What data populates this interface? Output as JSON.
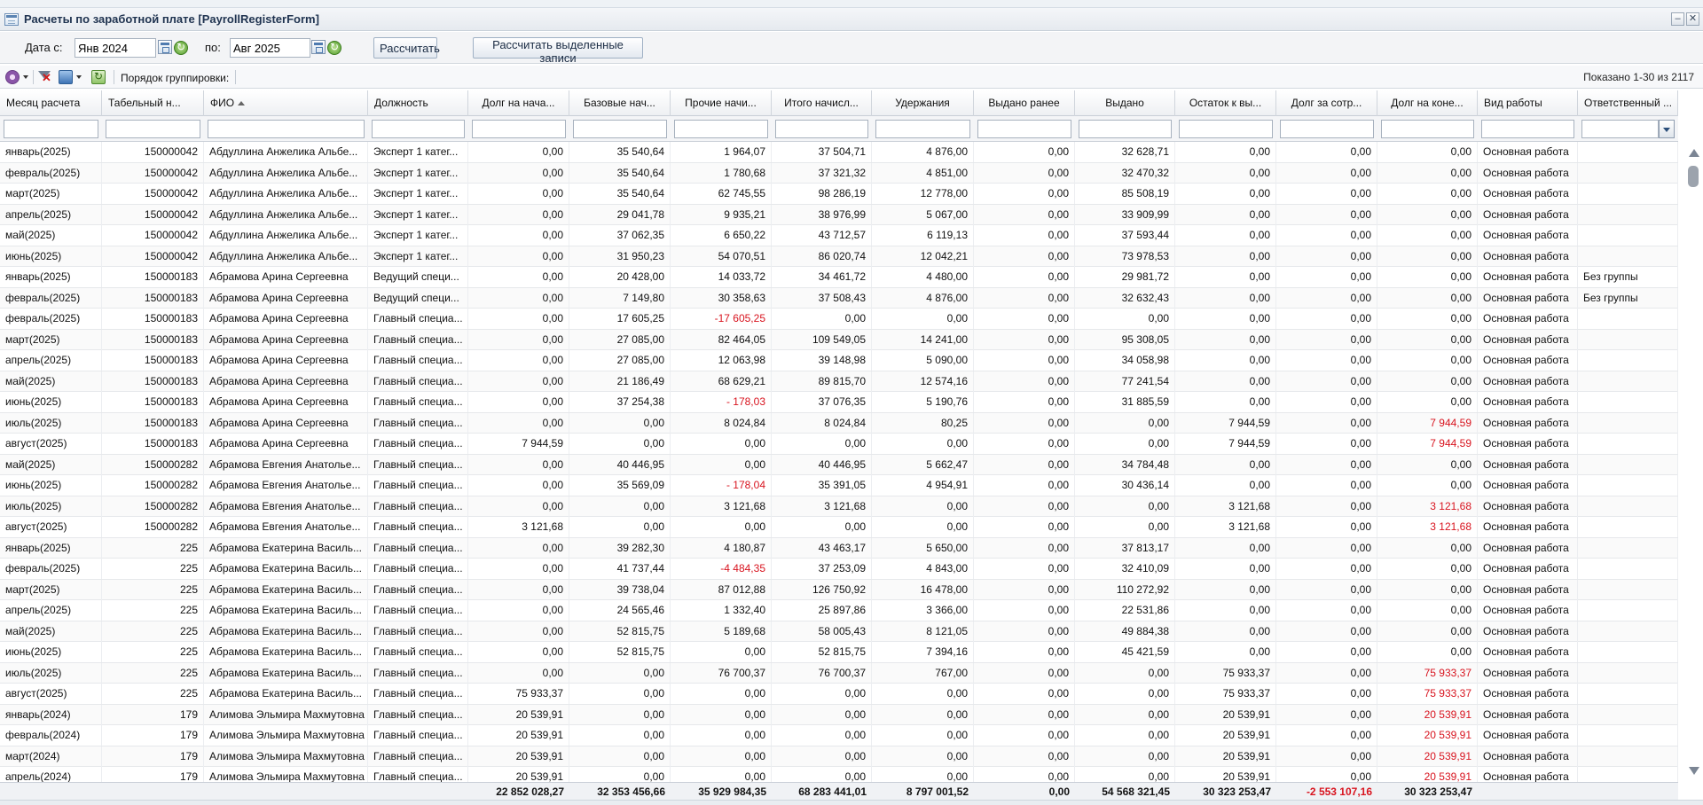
{
  "window": {
    "title": "Расчеты по заработной плате [PayrollRegisterForm]"
  },
  "filter": {
    "date_from_label": "Дата с:",
    "date_from_value": "Янв 2024",
    "date_to_label": "по:",
    "date_to_value": "Авг 2025",
    "calculate_label": "Рассчитать",
    "calculate_selected_label": "Рассчитать выделенные записи"
  },
  "toolbar": {
    "grouping_label": "Порядок группировки:",
    "paging": "Показано 1-30 из 2117"
  },
  "columns": [
    "Месяц расчета",
    "Табельный н...",
    "ФИО",
    "Должность",
    "Долг на нача...",
    "Базовые нач...",
    "Прочие начи...",
    "Итого начисл...",
    "Удержания",
    "Выдано ранее",
    "Выдано",
    "Остаток к вы...",
    "Долг за сотр...",
    "Долг на коне...",
    "Вид работы",
    "Ответственный ..."
  ],
  "rows": [
    [
      "январь(2025)",
      "150000042",
      "Абдуллина Анжелика Альбе...",
      "Эксперт 1 катег...",
      "0,00",
      "35 540,64",
      "1 964,07",
      "37 504,71",
      "4 876,00",
      "0,00",
      "32 628,71",
      "0,00",
      "0,00",
      "0,00",
      "Основная работа",
      ""
    ],
    [
      "февраль(2025)",
      "150000042",
      "Абдуллина Анжелика Альбе...",
      "Эксперт 1 катег...",
      "0,00",
      "35 540,64",
      "1 780,68",
      "37 321,32",
      "4 851,00",
      "0,00",
      "32 470,32",
      "0,00",
      "0,00",
      "0,00",
      "Основная работа",
      ""
    ],
    [
      "март(2025)",
      "150000042",
      "Абдуллина Анжелика Альбе...",
      "Эксперт 1 катег...",
      "0,00",
      "35 540,64",
      "62 745,55",
      "98 286,19",
      "12 778,00",
      "0,00",
      "85 508,19",
      "0,00",
      "0,00",
      "0,00",
      "Основная работа",
      ""
    ],
    [
      "апрель(2025)",
      "150000042",
      "Абдуллина Анжелика Альбе...",
      "Эксперт 1 катег...",
      "0,00",
      "29 041,78",
      "9 935,21",
      "38 976,99",
      "5 067,00",
      "0,00",
      "33 909,99",
      "0,00",
      "0,00",
      "0,00",
      "Основная работа",
      ""
    ],
    [
      "май(2025)",
      "150000042",
      "Абдуллина Анжелика Альбе...",
      "Эксперт 1 катег...",
      "0,00",
      "37 062,35",
      "6 650,22",
      "43 712,57",
      "6 119,13",
      "0,00",
      "37 593,44",
      "0,00",
      "0,00",
      "0,00",
      "Основная работа",
      ""
    ],
    [
      "июнь(2025)",
      "150000042",
      "Абдуллина Анжелика Альбе...",
      "Эксперт 1 катег...",
      "0,00",
      "31 950,23",
      "54 070,51",
      "86 020,74",
      "12 042,21",
      "0,00",
      "73 978,53",
      "0,00",
      "0,00",
      "0,00",
      "Основная работа",
      ""
    ],
    [
      "январь(2025)",
      "150000183",
      "Абрамова Арина Сергеевна",
      "Ведущий специ...",
      "0,00",
      "20 428,00",
      "14 033,72",
      "34 461,72",
      "4 480,00",
      "0,00",
      "29 981,72",
      "0,00",
      "0,00",
      "0,00",
      "Основная работа",
      "Без группы"
    ],
    [
      "февраль(2025)",
      "150000183",
      "Абрамова Арина Сергеевна",
      "Ведущий специ...",
      "0,00",
      "7 149,80",
      "30 358,63",
      "37 508,43",
      "4 876,00",
      "0,00",
      "32 632,43",
      "0,00",
      "0,00",
      "0,00",
      "Основная работа",
      "Без группы"
    ],
    [
      "февраль(2025)",
      "150000183",
      "Абрамова Арина Сергеевна",
      "Главный специа...",
      "0,00",
      "17 605,25",
      "-17 605,25",
      "0,00",
      "0,00",
      "0,00",
      "0,00",
      "0,00",
      "0,00",
      "0,00",
      "Основная работа",
      ""
    ],
    [
      "март(2025)",
      "150000183",
      "Абрамова Арина Сергеевна",
      "Главный специа...",
      "0,00",
      "27 085,00",
      "82 464,05",
      "109 549,05",
      "14 241,00",
      "0,00",
      "95 308,05",
      "0,00",
      "0,00",
      "0,00",
      "Основная работа",
      ""
    ],
    [
      "апрель(2025)",
      "150000183",
      "Абрамова Арина Сергеевна",
      "Главный специа...",
      "0,00",
      "27 085,00",
      "12 063,98",
      "39 148,98",
      "5 090,00",
      "0,00",
      "34 058,98",
      "0,00",
      "0,00",
      "0,00",
      "Основная работа",
      ""
    ],
    [
      "май(2025)",
      "150000183",
      "Абрамова Арина Сергеевна",
      "Главный специа...",
      "0,00",
      "21 186,49",
      "68 629,21",
      "89 815,70",
      "12 574,16",
      "0,00",
      "77 241,54",
      "0,00",
      "0,00",
      "0,00",
      "Основная работа",
      ""
    ],
    [
      "июнь(2025)",
      "150000183",
      "Абрамова Арина Сергеевна",
      "Главный специа...",
      "0,00",
      "37 254,38",
      "- 178,03",
      "37 076,35",
      "5 190,76",
      "0,00",
      "31 885,59",
      "0,00",
      "0,00",
      "0,00",
      "Основная работа",
      ""
    ],
    [
      "июль(2025)",
      "150000183",
      "Абрамова Арина Сергеевна",
      "Главный специа...",
      "0,00",
      "0,00",
      "8 024,84",
      "8 024,84",
      "80,25",
      "0,00",
      "0,00",
      "7 944,59",
      "0,00",
      "7 944,59",
      "Основная работа",
      ""
    ],
    [
      "август(2025)",
      "150000183",
      "Абрамова Арина Сергеевна",
      "Главный специа...",
      "7 944,59",
      "0,00",
      "0,00",
      "0,00",
      "0,00",
      "0,00",
      "0,00",
      "7 944,59",
      "0,00",
      "7 944,59",
      "Основная работа",
      ""
    ],
    [
      "май(2025)",
      "150000282",
      "Абрамова Евгения Анатолье...",
      "Главный специа...",
      "0,00",
      "40 446,95",
      "0,00",
      "40 446,95",
      "5 662,47",
      "0,00",
      "34 784,48",
      "0,00",
      "0,00",
      "0,00",
      "Основная работа",
      ""
    ],
    [
      "июнь(2025)",
      "150000282",
      "Абрамова Евгения Анатолье...",
      "Главный специа...",
      "0,00",
      "35 569,09",
      "- 178,04",
      "35 391,05",
      "4 954,91",
      "0,00",
      "30 436,14",
      "0,00",
      "0,00",
      "0,00",
      "Основная работа",
      ""
    ],
    [
      "июль(2025)",
      "150000282",
      "Абрамова Евгения Анатолье...",
      "Главный специа...",
      "0,00",
      "0,00",
      "3 121,68",
      "3 121,68",
      "0,00",
      "0,00",
      "0,00",
      "3 121,68",
      "0,00",
      "3 121,68",
      "Основная работа",
      ""
    ],
    [
      "август(2025)",
      "150000282",
      "Абрамова Евгения Анатолье...",
      "Главный специа...",
      "3 121,68",
      "0,00",
      "0,00",
      "0,00",
      "0,00",
      "0,00",
      "0,00",
      "3 121,68",
      "0,00",
      "3 121,68",
      "Основная работа",
      ""
    ],
    [
      "январь(2025)",
      "225",
      "Абрамова Екатерина Василь...",
      "Главный специа...",
      "0,00",
      "39 282,30",
      "4 180,87",
      "43 463,17",
      "5 650,00",
      "0,00",
      "37 813,17",
      "0,00",
      "0,00",
      "0,00",
      "Основная работа",
      ""
    ],
    [
      "февраль(2025)",
      "225",
      "Абрамова Екатерина Василь...",
      "Главный специа...",
      "0,00",
      "41 737,44",
      "-4 484,35",
      "37 253,09",
      "4 843,00",
      "0,00",
      "32 410,09",
      "0,00",
      "0,00",
      "0,00",
      "Основная работа",
      ""
    ],
    [
      "март(2025)",
      "225",
      "Абрамова Екатерина Василь...",
      "Главный специа...",
      "0,00",
      "39 738,04",
      "87 012,88",
      "126 750,92",
      "16 478,00",
      "0,00",
      "110 272,92",
      "0,00",
      "0,00",
      "0,00",
      "Основная работа",
      ""
    ],
    [
      "апрель(2025)",
      "225",
      "Абрамова Екатерина Василь...",
      "Главный специа...",
      "0,00",
      "24 565,46",
      "1 332,40",
      "25 897,86",
      "3 366,00",
      "0,00",
      "22 531,86",
      "0,00",
      "0,00",
      "0,00",
      "Основная работа",
      ""
    ],
    [
      "май(2025)",
      "225",
      "Абрамова Екатерина Василь...",
      "Главный специа...",
      "0,00",
      "52 815,75",
      "5 189,68",
      "58 005,43",
      "8 121,05",
      "0,00",
      "49 884,38",
      "0,00",
      "0,00",
      "0,00",
      "Основная работа",
      ""
    ],
    [
      "июнь(2025)",
      "225",
      "Абрамова Екатерина Василь...",
      "Главный специа...",
      "0,00",
      "52 815,75",
      "0,00",
      "52 815,75",
      "7 394,16",
      "0,00",
      "45 421,59",
      "0,00",
      "0,00",
      "0,00",
      "Основная работа",
      ""
    ],
    [
      "июль(2025)",
      "225",
      "Абрамова Екатерина Василь...",
      "Главный специа...",
      "0,00",
      "0,00",
      "76 700,37",
      "76 700,37",
      "767,00",
      "0,00",
      "0,00",
      "75 933,37",
      "0,00",
      "75 933,37",
      "Основная работа",
      ""
    ],
    [
      "август(2025)",
      "225",
      "Абрамова Екатерина Василь...",
      "Главный специа...",
      "75 933,37",
      "0,00",
      "0,00",
      "0,00",
      "0,00",
      "0,00",
      "0,00",
      "75 933,37",
      "0,00",
      "75 933,37",
      "Основная работа",
      ""
    ],
    [
      "январь(2024)",
      "179",
      "Алимова Эльмира Махмутовна",
      "Главный специа...",
      "20 539,91",
      "0,00",
      "0,00",
      "0,00",
      "0,00",
      "0,00",
      "0,00",
      "20 539,91",
      "0,00",
      "20 539,91",
      "Основная работа",
      ""
    ],
    [
      "февраль(2024)",
      "179",
      "Алимова Эльмира Махмутовна",
      "Главный специа...",
      "20 539,91",
      "0,00",
      "0,00",
      "0,00",
      "0,00",
      "0,00",
      "0,00",
      "20 539,91",
      "0,00",
      "20 539,91",
      "Основная работа",
      ""
    ],
    [
      "март(2024)",
      "179",
      "Алимова Эльмира Махмутовна",
      "Главный специа...",
      "20 539,91",
      "0,00",
      "0,00",
      "0,00",
      "0,00",
      "0,00",
      "0,00",
      "20 539,91",
      "0,00",
      "20 539,91",
      "Основная работа",
      ""
    ],
    [
      "апрель(2024)",
      "179",
      "Алимова Эльмира Махмутовна",
      "Главный специа...",
      "20 539,91",
      "0,00",
      "0,00",
      "0,00",
      "0,00",
      "0,00",
      "0,00",
      "20 539,91",
      "0,00",
      "20 539,91",
      "Основная работа",
      ""
    ]
  ],
  "totals": [
    "",
    "",
    "",
    "",
    "22 852 028,27",
    "32 353 456,66",
    "35 929 984,35",
    "68 283 441,01",
    "8 797 001,52",
    "0,00",
    "54 568 321,45",
    "30 323 253,47",
    "-2 553 107,16",
    "30 323 253,47",
    "",
    ""
  ],
  "colors": {
    "negative": "#d8141f",
    "accent": "#1f3350"
  }
}
